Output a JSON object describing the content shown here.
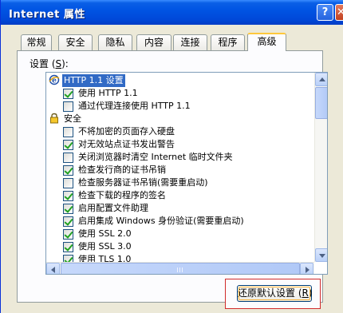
{
  "window": {
    "title": "Internet 属性"
  },
  "titlebar": {
    "help_label": "?",
    "close_label": "✕"
  },
  "tabs": [
    {
      "label": "常规",
      "active": false
    },
    {
      "label": "安全",
      "active": false
    },
    {
      "label": "隐私",
      "active": false
    },
    {
      "label": "内容",
      "active": false
    },
    {
      "label": "连接",
      "active": false
    },
    {
      "label": "程序",
      "active": false
    },
    {
      "label": "高级",
      "active": true
    }
  ],
  "settings": {
    "label": "设置 (",
    "mnemonic": "S",
    "label_suffix": "):"
  },
  "tree": [
    {
      "type": "group",
      "icon": "ie-globe-icon",
      "label": "HTTP 1.1 设置",
      "selected": true
    },
    {
      "type": "checkbox",
      "label": "使用 HTTP 1.1",
      "checked": true
    },
    {
      "type": "checkbox",
      "label": "通过代理连接使用 HTTP 1.1",
      "checked": false
    },
    {
      "type": "group",
      "icon": "lock-icon",
      "label": "安全",
      "selected": false
    },
    {
      "type": "checkbox",
      "label": "不将加密的页面存入硬盘",
      "checked": false
    },
    {
      "type": "checkbox",
      "label": "对无效站点证书发出警告",
      "checked": true
    },
    {
      "type": "checkbox",
      "label": "关闭浏览器时清空 Internet 临时文件夹",
      "checked": false
    },
    {
      "type": "checkbox",
      "label": "检查发行商的证书吊销",
      "checked": true
    },
    {
      "type": "checkbox",
      "label": "检查服务器证书吊销(需要重启动)",
      "checked": false
    },
    {
      "type": "checkbox",
      "label": "检查下载的程序的签名",
      "checked": true
    },
    {
      "type": "checkbox",
      "label": "启用配置文件助理",
      "checked": true
    },
    {
      "type": "checkbox",
      "label": "启用集成 Windows 身份验证(需要重启动)",
      "checked": true
    },
    {
      "type": "checkbox",
      "label": "使用 SSL 2.0",
      "checked": true
    },
    {
      "type": "checkbox",
      "label": "使用 SSL 3.0",
      "checked": true
    },
    {
      "type": "checkbox",
      "label": "使用 TLS 1.0",
      "checked": true
    }
  ],
  "restore_button": {
    "label": "还原默认设置 (",
    "mnemonic": "R",
    "label_suffix": ")"
  },
  "colors": {
    "titlebar": "#0054e3",
    "selection": "#316ac5",
    "highlight_box": "#d12b2b"
  }
}
